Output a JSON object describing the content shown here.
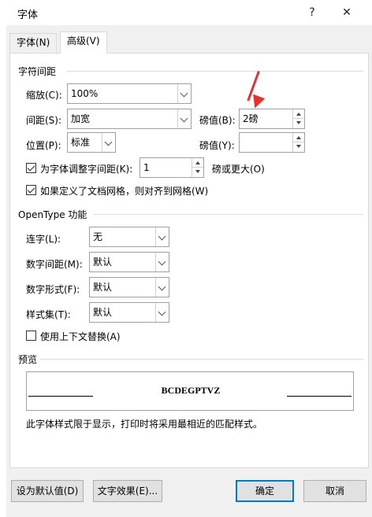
{
  "window": {
    "title": "字体",
    "help": "?",
    "close": "✕"
  },
  "tabs": [
    {
      "label": "字体(N)"
    },
    {
      "label": "高级(V)"
    }
  ],
  "spacing": {
    "section_title": "字符间距",
    "scale_label": "缩放(C):",
    "scale_value": "100%",
    "spacing_label": "间距(S):",
    "spacing_value": "加宽",
    "spacing_by_label": "磅值(B):",
    "spacing_by_value": "2磅",
    "position_label": "位置(P):",
    "position_value": "标准",
    "position_by_label": "磅值(Y):",
    "position_by_value": "",
    "kerning_label": "为字体调整字间距(K):",
    "kerning_value": "1",
    "kerning_suffix": "磅或更大(O)",
    "kerning_checked": true,
    "grid_label": "如果定义了文档网格，则对齐到网格(W)",
    "grid_checked": true
  },
  "opentype": {
    "section_title": "OpenType 功能",
    "ligatures_label": "连字(L):",
    "ligatures_value": "无",
    "num_spacing_label": "数字间距(M):",
    "num_spacing_value": "默认",
    "num_forms_label": "数字形式(F):",
    "num_forms_value": "默认",
    "stylistic_label": "样式集(T):",
    "stylistic_value": "默认",
    "contextual_label": "使用上下文替换(A)",
    "contextual_checked": false
  },
  "preview": {
    "section_title": "预览",
    "sample": "BCDEGPTVZ",
    "note": "此字体样式限于显示，打印时将采用最相近的匹配样式。"
  },
  "buttons": {
    "set_default": "设为默认值(D)",
    "text_effects": "文字效果(E)...",
    "ok": "确定",
    "cancel": "取消"
  },
  "colors": {
    "accent": "#0078d7",
    "annotation_arrow": "#e3322f"
  }
}
